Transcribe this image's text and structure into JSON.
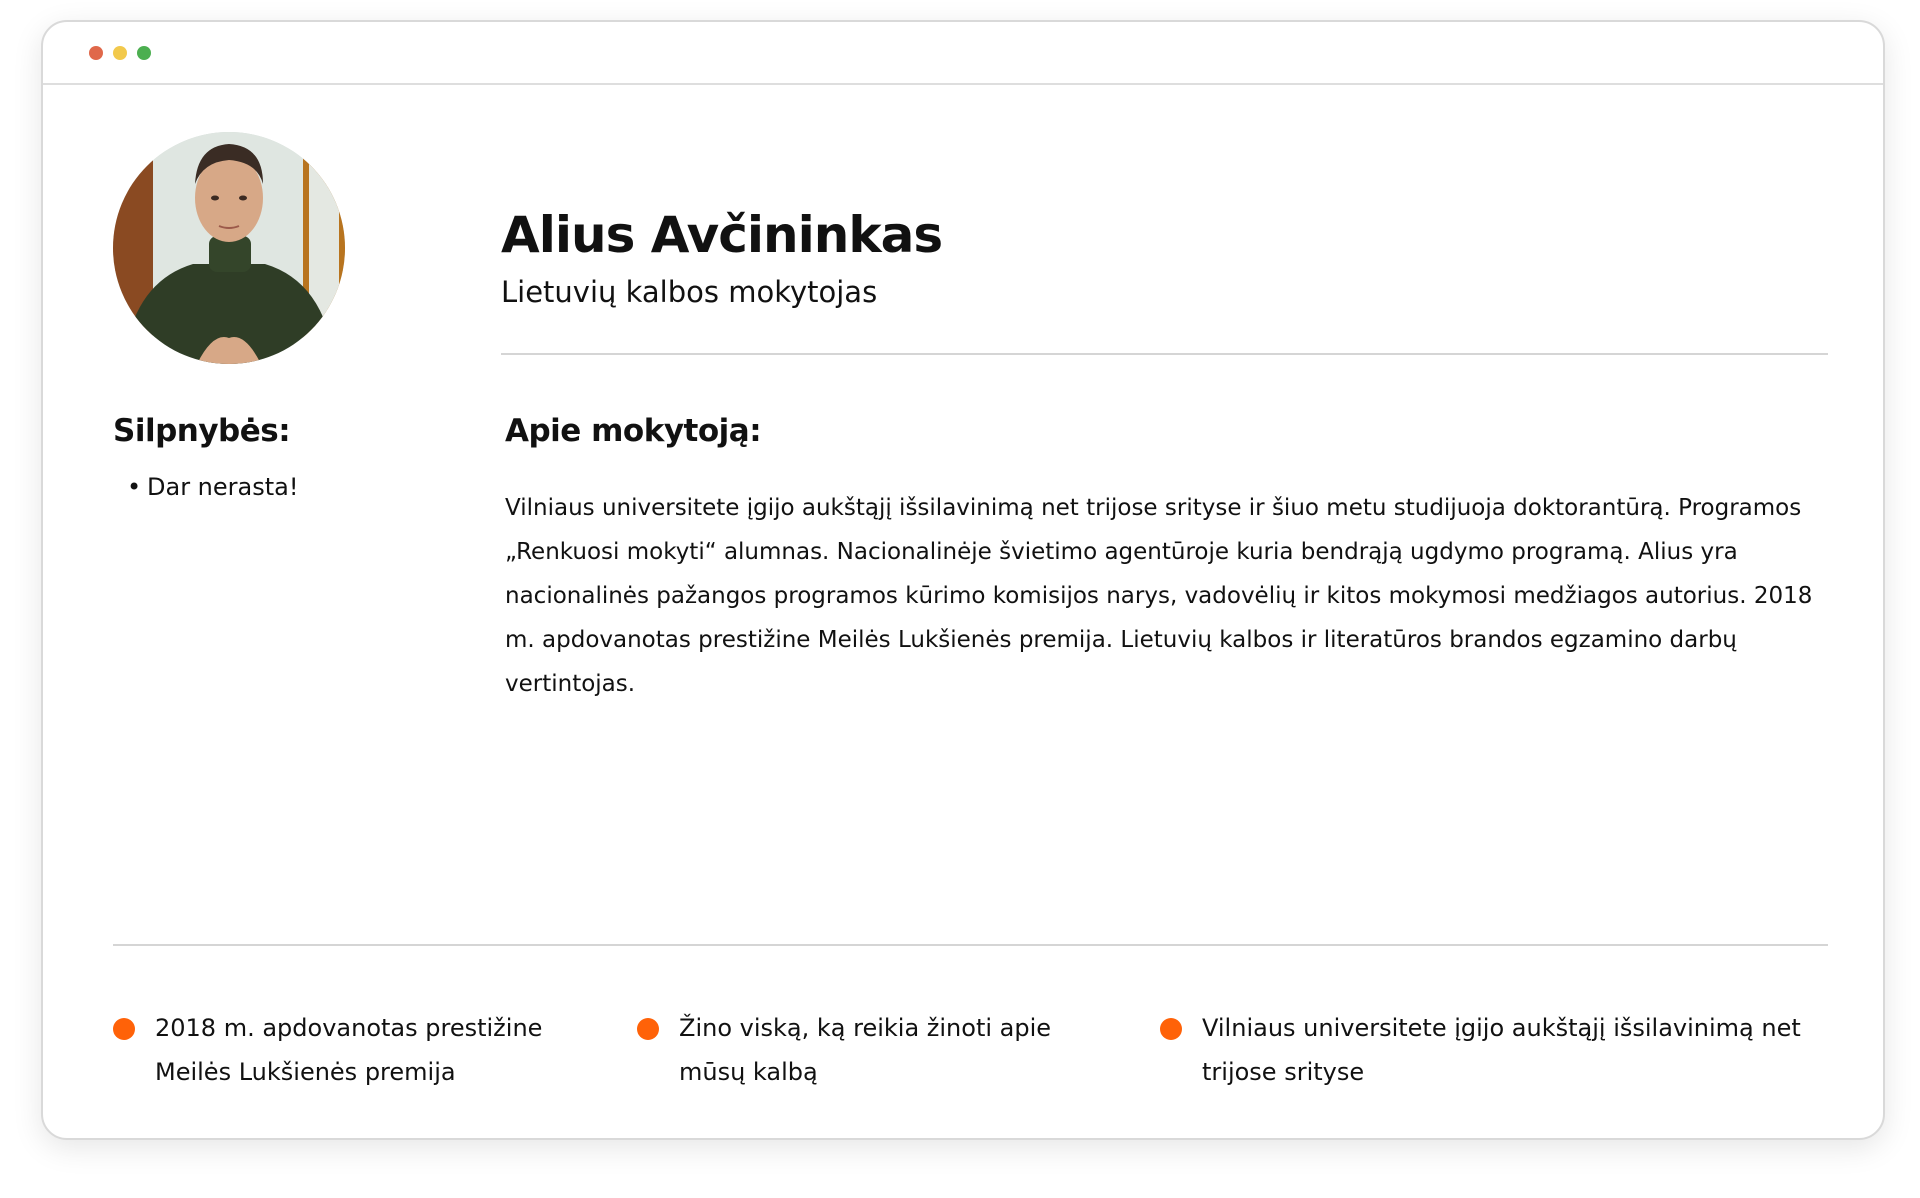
{
  "colors": {
    "accent": "#ff6208",
    "window_dot_red": "#e0684a",
    "window_dot_yellow": "#f2c94c",
    "window_dot_green": "#4caf50"
  },
  "profile": {
    "photo_alt": "Alius Avčininkas",
    "name": "Alius Avčininkas",
    "role": "Lietuvių kalbos mokytojas"
  },
  "weaknesses": {
    "title": "Silpnybės:",
    "items": [
      "Dar nerasta!"
    ]
  },
  "about": {
    "title": "Apie mokytoją:",
    "text": "Vilniaus universitete įgijo aukštąjį išsilavinimą net trijose srityse ir šiuo metu studijuoja doktorantūrą. Programos „Renkuosi mokyti“ alumnas. Nacionalinėje švietimo agentūroje kuria bendrąją ugdymo programą. Alius yra nacionalinės pažangos programos kūrimo komisijos narys, vadovėlių ir kitos mokymosi medžiagos autorius. 2018 m. apdovanotas prestižine Meilės Lukšienės premija. Lietuvių kalbos ir literatūros brandos egzamino darbų vertintojas."
  },
  "highlights": [
    {
      "text": "2018 m. apdovanotas prestižine Meilės Lukšienės premija"
    },
    {
      "text": "Žino viską, ką reikia žinoti apie mūsų kalbą"
    },
    {
      "text": "Vilniaus universitete įgijo aukštąjį išsilavinimą net trijose srityse"
    }
  ]
}
